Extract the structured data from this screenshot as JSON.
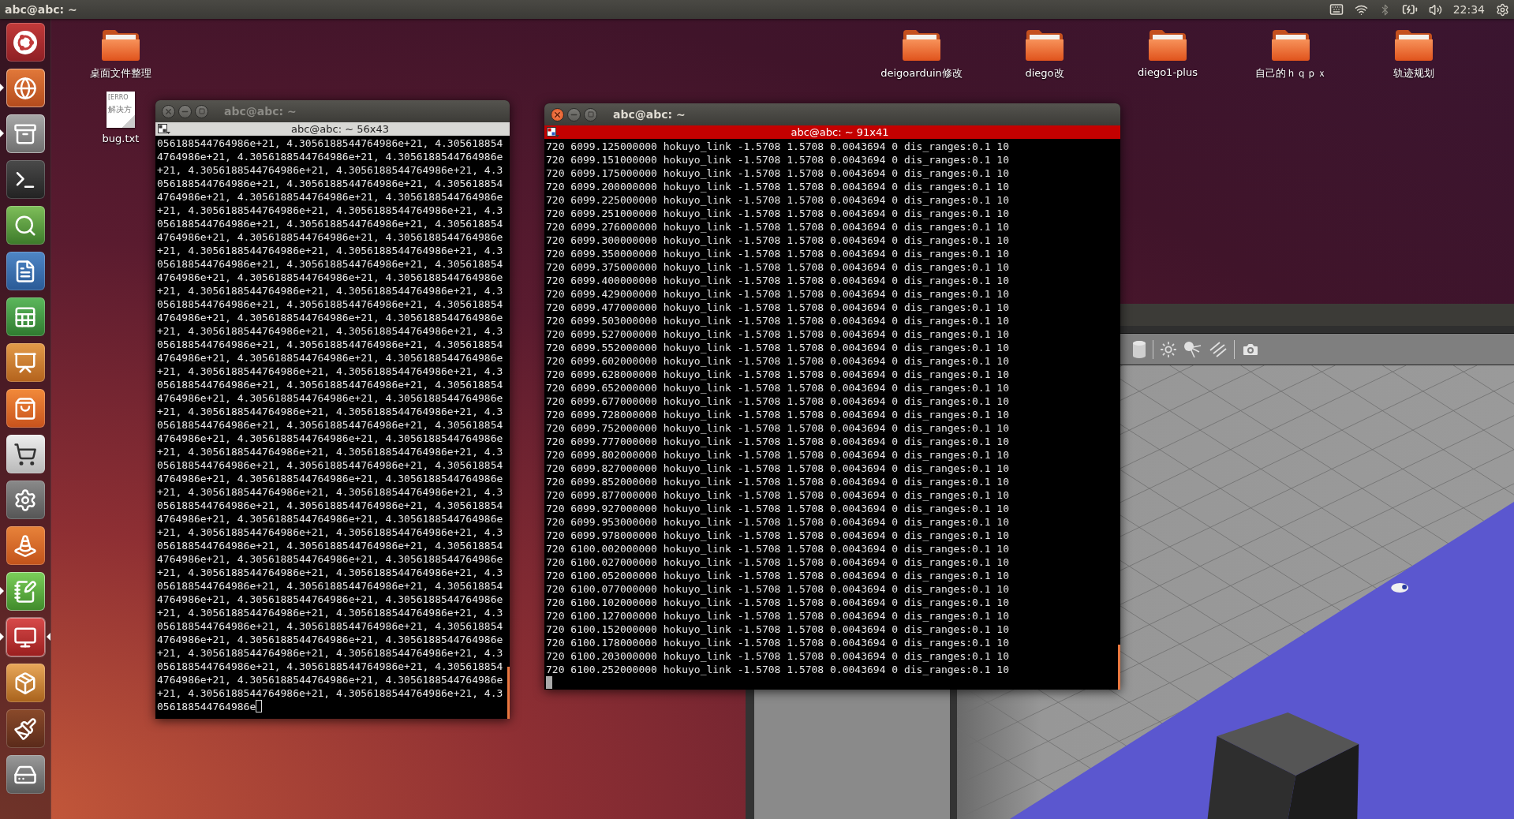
{
  "top_bar": {
    "title": "abc@abc: ~",
    "clock": "22:34"
  },
  "launcher": [
    {
      "running": false,
      "focused": false
    },
    {
      "running": true,
      "focused": false
    },
    {
      "running": true,
      "focused": false
    },
    {
      "running": false,
      "focused": false
    },
    {
      "running": false,
      "focused": false
    },
    {
      "running": false,
      "focused": false
    },
    {
      "running": false,
      "focused": false
    },
    {
      "running": false,
      "focused": false
    },
    {
      "running": false,
      "focused": false
    },
    {
      "running": false,
      "focused": false
    },
    {
      "running": false,
      "focused": false
    },
    {
      "running": false,
      "focused": false
    },
    {
      "running": true,
      "focused": false
    },
    {
      "running": true,
      "focused": true
    },
    {
      "running": false,
      "focused": false
    },
    {
      "running": false,
      "focused": false
    },
    {
      "running": false,
      "focused": false
    }
  ],
  "desktop": {
    "left_icons": [
      {
        "kind": "folder",
        "label": "桌面文件整理"
      },
      {
        "kind": "file",
        "label": "bug.txt",
        "preview": [
          "[ERRO",
          "解决方"
        ]
      }
    ],
    "top_icons": [
      {
        "kind": "folder",
        "label": "deigoarduin修改"
      },
      {
        "kind": "folder",
        "label": "diego改"
      },
      {
        "kind": "folder",
        "label": "diego1-plus"
      },
      {
        "kind": "folder",
        "label": "自己的ｈｑｐｘ"
      },
      {
        "kind": "folder",
        "label": "轨迹规划"
      }
    ]
  },
  "terminals": [
    {
      "title": "abc@abc: ~",
      "tab_title": "abc@abc: ~ 56x43",
      "focused": false,
      "lines": [
        "056188544764986e+21, 4.3056188544764986e+21, 4.305618854",
        "4764986e+21, 4.3056188544764986e+21, 4.3056188544764986e",
        "+21, 4.3056188544764986e+21, 4.3056188544764986e+21, 4.3",
        "056188544764986e+21, 4.3056188544764986e+21, 4.305618854",
        "4764986e+21, 4.3056188544764986e+21, 4.3056188544764986e",
        "+21, 4.3056188544764986e+21, 4.3056188544764986e+21, 4.3",
        "056188544764986e+21, 4.3056188544764986e+21, 4.305618854",
        "4764986e+21, 4.3056188544764986e+21, 4.3056188544764986e",
        "+21, 4.3056188544764986e+21, 4.3056188544764986e+21, 4.3",
        "056188544764986e+21, 4.3056188544764986e+21, 4.305618854",
        "4764986e+21, 4.3056188544764986e+21, 4.3056188544764986e",
        "+21, 4.3056188544764986e+21, 4.3056188544764986e+21, 4.3",
        "056188544764986e+21, 4.3056188544764986e+21, 4.305618854",
        "4764986e+21, 4.3056188544764986e+21, 4.3056188544764986e",
        "+21, 4.3056188544764986e+21, 4.3056188544764986e+21, 4.3",
        "056188544764986e+21, 4.3056188544764986e+21, 4.305618854",
        "4764986e+21, 4.3056188544764986e+21, 4.3056188544764986e",
        "+21, 4.3056188544764986e+21, 4.3056188544764986e+21, 4.3",
        "056188544764986e+21, 4.3056188544764986e+21, 4.305618854",
        "4764986e+21, 4.3056188544764986e+21, 4.3056188544764986e",
        "+21, 4.3056188544764986e+21, 4.3056188544764986e+21, 4.3",
        "056188544764986e+21, 4.3056188544764986e+21, 4.305618854",
        "4764986e+21, 4.3056188544764986e+21, 4.3056188544764986e",
        "+21, 4.3056188544764986e+21, 4.3056188544764986e+21, 4.3",
        "056188544764986e+21, 4.3056188544764986e+21, 4.305618854",
        "4764986e+21, 4.3056188544764986e+21, 4.3056188544764986e",
        "+21, 4.3056188544764986e+21, 4.3056188544764986e+21, 4.3",
        "056188544764986e+21, 4.3056188544764986e+21, 4.305618854",
        "4764986e+21, 4.3056188544764986e+21, 4.3056188544764986e",
        "+21, 4.3056188544764986e+21, 4.3056188544764986e+21, 4.3",
        "056188544764986e+21, 4.3056188544764986e+21, 4.305618854",
        "4764986e+21, 4.3056188544764986e+21, 4.3056188544764986e",
        "+21, 4.3056188544764986e+21, 4.3056188544764986e+21, 4.3",
        "056188544764986e+21, 4.3056188544764986e+21, 4.305618854",
        "4764986e+21, 4.3056188544764986e+21, 4.3056188544764986e",
        "+21, 4.3056188544764986e+21, 4.3056188544764986e+21, 4.3",
        "056188544764986e+21, 4.3056188544764986e+21, 4.305618854",
        "4764986e+21, 4.3056188544764986e+21, 4.3056188544764986e",
        "+21, 4.3056188544764986e+21, 4.3056188544764986e+21, 4.3",
        "056188544764986e+21, 4.3056188544764986e+21, 4.305618854",
        "4764986e+21, 4.3056188544764986e+21, 4.3056188544764986e",
        "+21, 4.3056188544764986e+21, 4.3056188544764986e+21, 4.3",
        "056188544764986e"
      ]
    },
    {
      "title": "abc@abc: ~",
      "tab_title": "abc@abc: ~ 91x41",
      "focused": true,
      "lines": [
        "720 6099.125000000 hokuyo_link -1.5708 1.5708 0.0043694 0 dis_ranges:0.1 10",
        "720 6099.151000000 hokuyo_link -1.5708 1.5708 0.0043694 0 dis_ranges:0.1 10",
        "720 6099.175000000 hokuyo_link -1.5708 1.5708 0.0043694 0 dis_ranges:0.1 10",
        "720 6099.200000000 hokuyo_link -1.5708 1.5708 0.0043694 0 dis_ranges:0.1 10",
        "720 6099.225000000 hokuyo_link -1.5708 1.5708 0.0043694 0 dis_ranges:0.1 10",
        "720 6099.251000000 hokuyo_link -1.5708 1.5708 0.0043694 0 dis_ranges:0.1 10",
        "720 6099.276000000 hokuyo_link -1.5708 1.5708 0.0043694 0 dis_ranges:0.1 10",
        "720 6099.300000000 hokuyo_link -1.5708 1.5708 0.0043694 0 dis_ranges:0.1 10",
        "720 6099.350000000 hokuyo_link -1.5708 1.5708 0.0043694 0 dis_ranges:0.1 10",
        "720 6099.375000000 hokuyo_link -1.5708 1.5708 0.0043694 0 dis_ranges:0.1 10",
        "720 6099.400000000 hokuyo_link -1.5708 1.5708 0.0043694 0 dis_ranges:0.1 10",
        "720 6099.429000000 hokuyo_link -1.5708 1.5708 0.0043694 0 dis_ranges:0.1 10",
        "720 6099.477000000 hokuyo_link -1.5708 1.5708 0.0043694 0 dis_ranges:0.1 10",
        "720 6099.503000000 hokuyo_link -1.5708 1.5708 0.0043694 0 dis_ranges:0.1 10",
        "720 6099.527000000 hokuyo_link -1.5708 1.5708 0.0043694 0 dis_ranges:0.1 10",
        "720 6099.552000000 hokuyo_link -1.5708 1.5708 0.0043694 0 dis_ranges:0.1 10",
        "720 6099.602000000 hokuyo_link -1.5708 1.5708 0.0043694 0 dis_ranges:0.1 10",
        "720 6099.628000000 hokuyo_link -1.5708 1.5708 0.0043694 0 dis_ranges:0.1 10",
        "720 6099.652000000 hokuyo_link -1.5708 1.5708 0.0043694 0 dis_ranges:0.1 10",
        "720 6099.677000000 hokuyo_link -1.5708 1.5708 0.0043694 0 dis_ranges:0.1 10",
        "720 6099.728000000 hokuyo_link -1.5708 1.5708 0.0043694 0 dis_ranges:0.1 10",
        "720 6099.752000000 hokuyo_link -1.5708 1.5708 0.0043694 0 dis_ranges:0.1 10",
        "720 6099.777000000 hokuyo_link -1.5708 1.5708 0.0043694 0 dis_ranges:0.1 10",
        "720 6099.802000000 hokuyo_link -1.5708 1.5708 0.0043694 0 dis_ranges:0.1 10",
        "720 6099.827000000 hokuyo_link -1.5708 1.5708 0.0043694 0 dis_ranges:0.1 10",
        "720 6099.852000000 hokuyo_link -1.5708 1.5708 0.0043694 0 dis_ranges:0.1 10",
        "720 6099.877000000 hokuyo_link -1.5708 1.5708 0.0043694 0 dis_ranges:0.1 10",
        "720 6099.927000000 hokuyo_link -1.5708 1.5708 0.0043694 0 dis_ranges:0.1 10",
        "720 6099.953000000 hokuyo_link -1.5708 1.5708 0.0043694 0 dis_ranges:0.1 10",
        "720 6099.978000000 hokuyo_link -1.5708 1.5708 0.0043694 0 dis_ranges:0.1 10",
        "720 6100.002000000 hokuyo_link -1.5708 1.5708 0.0043694 0 dis_ranges:0.1 10",
        "720 6100.027000000 hokuyo_link -1.5708 1.5708 0.0043694 0 dis_ranges:0.1 10",
        "720 6100.052000000 hokuyo_link -1.5708 1.5708 0.0043694 0 dis_ranges:0.1 10",
        "720 6100.077000000 hokuyo_link -1.5708 1.5708 0.0043694 0 dis_ranges:0.1 10",
        "720 6100.102000000 hokuyo_link -1.5708 1.5708 0.0043694 0 dis_ranges:0.1 10",
        "720 6100.127000000 hokuyo_link -1.5708 1.5708 0.0043694 0 dis_ranges:0.1 10",
        "720 6100.152000000 hokuyo_link -1.5708 1.5708 0.0043694 0 dis_ranges:0.1 10",
        "720 6100.178000000 hokuyo_link -1.5708 1.5708 0.0043694 0 dis_ranges:0.1 10",
        "720 6100.203000000 hokuyo_link -1.5708 1.5708 0.0043694 0 dis_ranges:0.1 10",
        "720 6100.252000000 hokuyo_link -1.5708 1.5708 0.0043694 0 dis_ranges:0.1 10"
      ]
    }
  ]
}
